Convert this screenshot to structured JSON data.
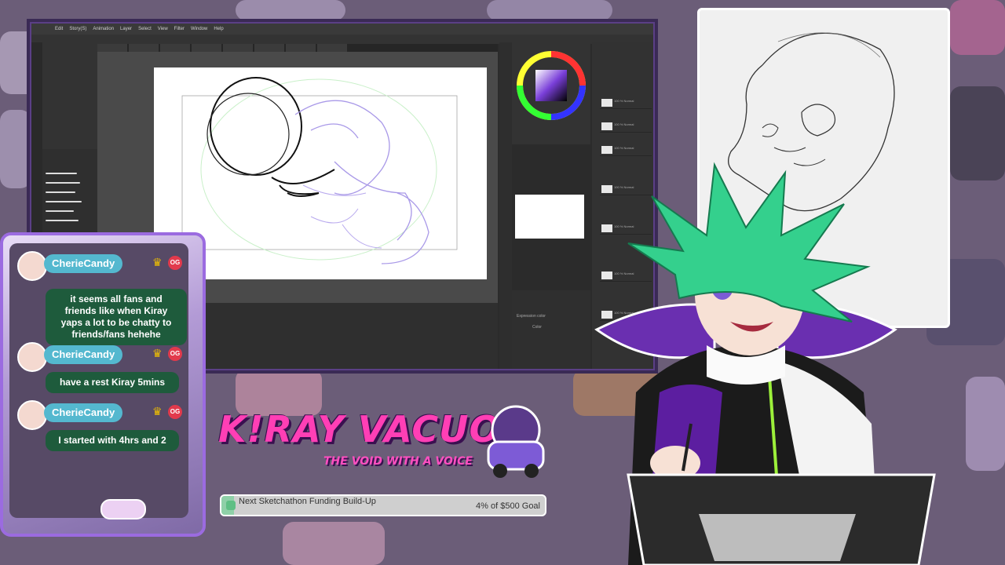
{
  "app": {
    "menu": [
      "Edit",
      "Story(S)",
      "Animation",
      "Layer",
      "Select",
      "View",
      "Filter",
      "Window",
      "Help"
    ],
    "layers": [
      "100 % Normal",
      "100 % Normal",
      "100 % Normal",
      "100 % Normal",
      "100 % Normal",
      "100 % Normal",
      "100 % Normal"
    ],
    "panels": {
      "expression_color": "Expression color",
      "color_mode": "Color"
    }
  },
  "chat": {
    "messages": [
      {
        "user": "CherieCandy",
        "badge": "OG",
        "text": "it seems all fans and friends like when Kiray yaps a lot to be chatty to friends/fans hehehe"
      },
      {
        "user": "CherieCandy",
        "badge": "OG",
        "text": "have a rest Kiray 5mins"
      },
      {
        "user": "CherieCandy",
        "badge": "OG",
        "text": "I started with 4hrs and 2"
      }
    ]
  },
  "logo": {
    "title": "K!RAY VACUO",
    "subtitle": "THE VOID WITH A VOICE"
  },
  "funding": {
    "label": "Next Sketchathon Funding Build-Up",
    "goal_text": "4% of $500 Goal",
    "progress_fraction": 0.04
  },
  "colors": {
    "accent": "#ff3fb5",
    "frame": "#9b6be0",
    "hair": "#3bd48a"
  }
}
